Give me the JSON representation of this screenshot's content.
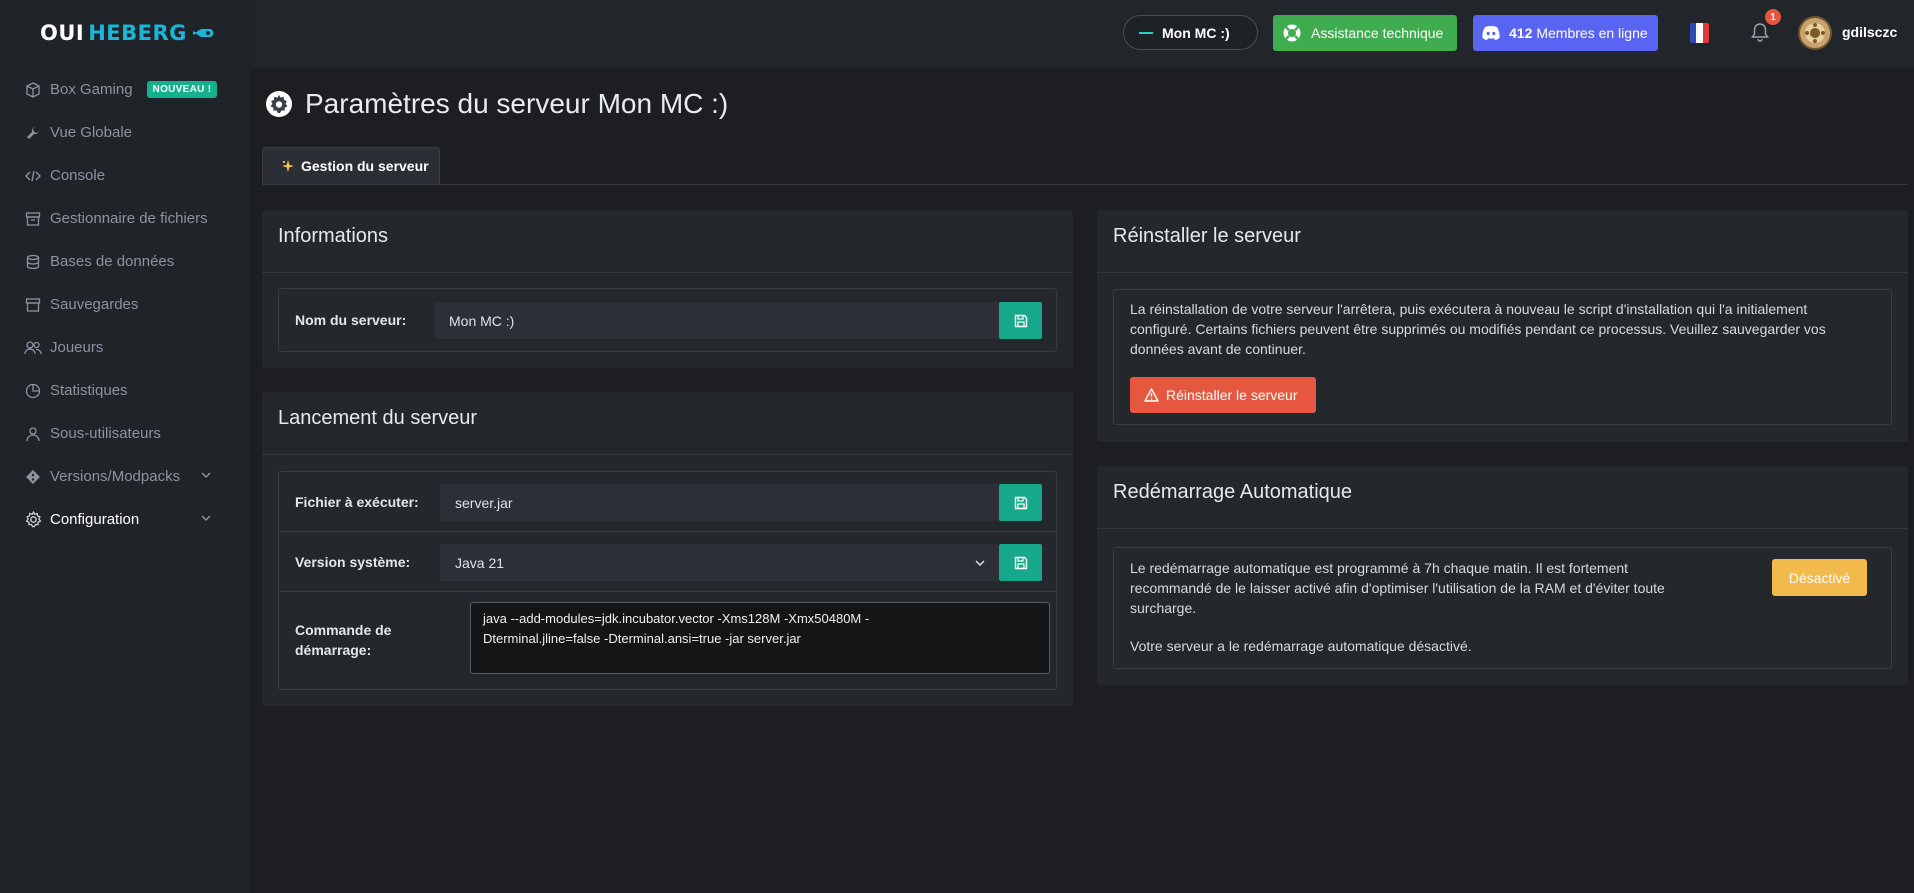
{
  "brand": {
    "part1": "OUI",
    "part2": "HEBERG"
  },
  "sidebar": {
    "items": [
      {
        "label": "Box Gaming",
        "badge": "NOUVEAU !"
      },
      {
        "label": "Vue Globale"
      },
      {
        "label": "Console"
      },
      {
        "label": "Gestionnaire de fichiers"
      },
      {
        "label": "Bases de données"
      },
      {
        "label": "Sauvegardes"
      },
      {
        "label": "Joueurs"
      },
      {
        "label": "Statistiques"
      },
      {
        "label": "Sous-utilisateurs"
      },
      {
        "label": "Versions/Modpacks"
      },
      {
        "label": "Configuration"
      }
    ]
  },
  "topbar": {
    "server_name": "Mon MC :)",
    "support_label": "Assistance technique",
    "discord_count": "412",
    "discord_label": "Membres en ligne",
    "notification_count": "1",
    "username": "gdilsczc"
  },
  "page": {
    "title": "Paramètres du serveur Mon MC :)",
    "tab_label": "Gestion du serveur"
  },
  "informations": {
    "title": "Informations",
    "server_name_label": "Nom du serveur:",
    "server_name_value": "Mon MC :)"
  },
  "launch": {
    "title": "Lancement du serveur",
    "file_label": "Fichier à exécuter:",
    "file_value": "server.jar",
    "version_label": "Version système:",
    "version_value": "Java 21",
    "command_label_1": "Commande de",
    "command_label_2": "démarrage:",
    "command_line_1": "java --add-modules=jdk.incubator.vector -Xms128M -Xmx50480M -",
    "command_line_2": "Dterminal.jline=false -Dterminal.ansi=true -jar server.jar"
  },
  "reinstall": {
    "title": "Réinstaller le serveur",
    "text_line_1": "La réinstallation de votre serveur l'arrêtera, puis exécutera à nouveau le script d'installation qui l'a initialement",
    "text_line_2": "configuré. Certains fichiers peuvent être supprimés ou modifiés pendant ce processus. Veuillez sauvegarder vos",
    "text_line_3": "données avant de continuer.",
    "button_label": "Réinstaller le serveur"
  },
  "autorestart": {
    "title": "Redémarrage Automatique",
    "text_line_1": "Le redémarrage automatique est programmé à 7h chaque matin. Il est fortement",
    "text_line_2": "recommandé de le laisser activé afin d'optimiser l'utilisation de la RAM et d'éviter toute",
    "text_line_3": "surcharge.",
    "status_text": "Votre serveur a le redémarrage automatique désactivé.",
    "button_label": "Désactivé"
  },
  "colors": {
    "accent_teal": "#16a88a",
    "danger": "#e5573f",
    "warning": "#f2b94b",
    "support_green": "#3fad4f",
    "discord": "#5865f2"
  }
}
